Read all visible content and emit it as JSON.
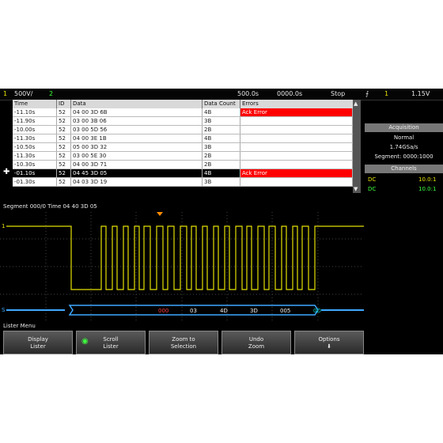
{
  "status_bar": {
    "channel": "1",
    "ch1_scale": "500V/",
    "ch2": "2",
    "timebase": "500.0s",
    "delay": "0000.0s",
    "mode": "Stop",
    "trig_icon": "trigger-edge-icon",
    "trig_channel": "1",
    "trig_level": "1.15V"
  },
  "table": {
    "headers": [
      "Time",
      "ID",
      "Data",
      "Data Count",
      "Errors"
    ],
    "rows": [
      {
        "time": "-11.10s",
        "id": "52",
        "data": "04 00 3D 6B",
        "count": "4B",
        "error": "Ack Error",
        "flag": true
      },
      {
        "time": "-11.90s",
        "id": "52",
        "data": "03 00 3B 06",
        "count": "3B",
        "error": "",
        "flag": false
      },
      {
        "time": "-10.00s",
        "id": "52",
        "data": "03 00 5D 56",
        "count": "2B",
        "error": "",
        "flag": false
      },
      {
        "time": "-11.30s",
        "id": "52",
        "data": "04 00 3E 1B",
        "count": "4B",
        "error": "",
        "flag": false
      },
      {
        "time": "-10.50s",
        "id": "52",
        "data": "05 00 3D 32",
        "count": "3B",
        "error": "",
        "flag": false
      },
      {
        "time": "-11.30s",
        "id": "52",
        "data": "03 00 5E 30",
        "count": "2B",
        "error": "",
        "flag": false
      },
      {
        "time": "-10.30s",
        "id": "52",
        "data": "04 00 3D 71",
        "count": "2B",
        "error": "",
        "flag": false
      },
      {
        "time": "-01.10s",
        "id": "52",
        "data": "04 45 3D 05",
        "count": "4B",
        "error": "Ack Error",
        "flag": true
      },
      {
        "time": "-01.30s",
        "id": "52",
        "data": "04 03 3D 19",
        "count": "3B",
        "error": "",
        "flag": false
      }
    ]
  },
  "right_panel": {
    "acq_title": "Acquisition",
    "acq_mode": "Normal",
    "acq_rate": "1.74GSa/s",
    "segment": "Segment: 0000:1000",
    "channels_title": "Channels",
    "ch1_label": "DC",
    "ch1_value": "10.0:1",
    "ch2_label": "DC",
    "ch2_value": "10.0:1"
  },
  "segment_line": "Segment 000/0 Time 04  40  3D  05",
  "decode": {
    "label": "S",
    "packets": [
      "000",
      "03",
      "4D",
      "3D",
      "005",
      "0D"
    ],
    "colors": {
      "id": "#ff3b3b",
      "data": "#f2f2f2",
      "crc": "#00d6c8",
      "bus": "#3fa9ff"
    }
  },
  "waveform_color": "#e4e000",
  "menu_title": "Lister Menu",
  "softkeys": [
    {
      "line1": "Display",
      "line2": "Lister",
      "icon": ""
    },
    {
      "line1": "Scroll",
      "line2": "Lister",
      "icon": "knob-icon"
    },
    {
      "line1": "Zoom to",
      "line2": "Selection",
      "icon": ""
    },
    {
      "line1": "Undo",
      "line2": "Zoom",
      "icon": ""
    },
    {
      "line1": "Options",
      "line2": "",
      "icon": "arrow-down-icon"
    }
  ]
}
